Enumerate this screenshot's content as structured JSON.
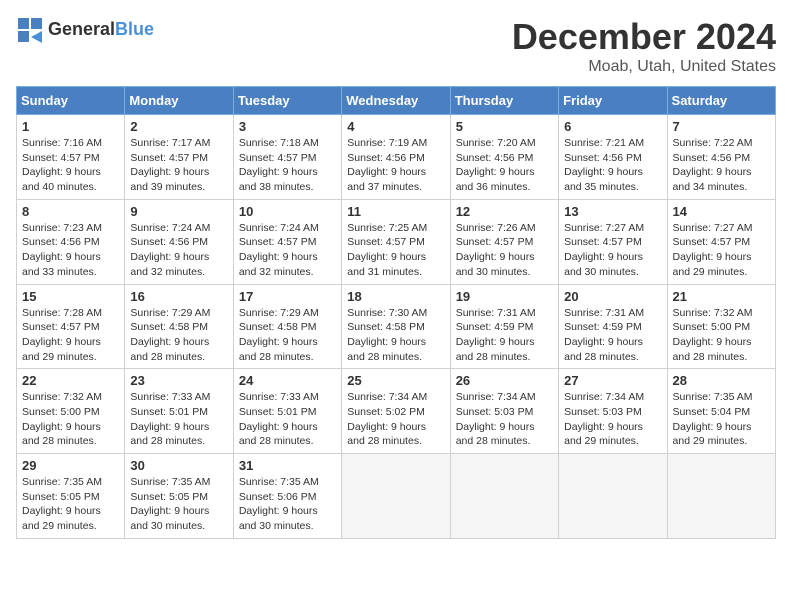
{
  "header": {
    "logo_general": "General",
    "logo_blue": "Blue",
    "month": "December 2024",
    "location": "Moab, Utah, United States"
  },
  "weekdays": [
    "Sunday",
    "Monday",
    "Tuesday",
    "Wednesday",
    "Thursday",
    "Friday",
    "Saturday"
  ],
  "weeks": [
    [
      {
        "day": "1",
        "info": "Sunrise: 7:16 AM\nSunset: 4:57 PM\nDaylight: 9 hours\nand 40 minutes."
      },
      {
        "day": "2",
        "info": "Sunrise: 7:17 AM\nSunset: 4:57 PM\nDaylight: 9 hours\nand 39 minutes."
      },
      {
        "day": "3",
        "info": "Sunrise: 7:18 AM\nSunset: 4:57 PM\nDaylight: 9 hours\nand 38 minutes."
      },
      {
        "day": "4",
        "info": "Sunrise: 7:19 AM\nSunset: 4:56 PM\nDaylight: 9 hours\nand 37 minutes."
      },
      {
        "day": "5",
        "info": "Sunrise: 7:20 AM\nSunset: 4:56 PM\nDaylight: 9 hours\nand 36 minutes."
      },
      {
        "day": "6",
        "info": "Sunrise: 7:21 AM\nSunset: 4:56 PM\nDaylight: 9 hours\nand 35 minutes."
      },
      {
        "day": "7",
        "info": "Sunrise: 7:22 AM\nSunset: 4:56 PM\nDaylight: 9 hours\nand 34 minutes."
      }
    ],
    [
      {
        "day": "8",
        "info": "Sunrise: 7:23 AM\nSunset: 4:56 PM\nDaylight: 9 hours\nand 33 minutes."
      },
      {
        "day": "9",
        "info": "Sunrise: 7:24 AM\nSunset: 4:56 PM\nDaylight: 9 hours\nand 32 minutes."
      },
      {
        "day": "10",
        "info": "Sunrise: 7:24 AM\nSunset: 4:57 PM\nDaylight: 9 hours\nand 32 minutes."
      },
      {
        "day": "11",
        "info": "Sunrise: 7:25 AM\nSunset: 4:57 PM\nDaylight: 9 hours\nand 31 minutes."
      },
      {
        "day": "12",
        "info": "Sunrise: 7:26 AM\nSunset: 4:57 PM\nDaylight: 9 hours\nand 30 minutes."
      },
      {
        "day": "13",
        "info": "Sunrise: 7:27 AM\nSunset: 4:57 PM\nDaylight: 9 hours\nand 30 minutes."
      },
      {
        "day": "14",
        "info": "Sunrise: 7:27 AM\nSunset: 4:57 PM\nDaylight: 9 hours\nand 29 minutes."
      }
    ],
    [
      {
        "day": "15",
        "info": "Sunrise: 7:28 AM\nSunset: 4:57 PM\nDaylight: 9 hours\nand 29 minutes."
      },
      {
        "day": "16",
        "info": "Sunrise: 7:29 AM\nSunset: 4:58 PM\nDaylight: 9 hours\nand 28 minutes."
      },
      {
        "day": "17",
        "info": "Sunrise: 7:29 AM\nSunset: 4:58 PM\nDaylight: 9 hours\nand 28 minutes."
      },
      {
        "day": "18",
        "info": "Sunrise: 7:30 AM\nSunset: 4:58 PM\nDaylight: 9 hours\nand 28 minutes."
      },
      {
        "day": "19",
        "info": "Sunrise: 7:31 AM\nSunset: 4:59 PM\nDaylight: 9 hours\nand 28 minutes."
      },
      {
        "day": "20",
        "info": "Sunrise: 7:31 AM\nSunset: 4:59 PM\nDaylight: 9 hours\nand 28 minutes."
      },
      {
        "day": "21",
        "info": "Sunrise: 7:32 AM\nSunset: 5:00 PM\nDaylight: 9 hours\nand 28 minutes."
      }
    ],
    [
      {
        "day": "22",
        "info": "Sunrise: 7:32 AM\nSunset: 5:00 PM\nDaylight: 9 hours\nand 28 minutes."
      },
      {
        "day": "23",
        "info": "Sunrise: 7:33 AM\nSunset: 5:01 PM\nDaylight: 9 hours\nand 28 minutes."
      },
      {
        "day": "24",
        "info": "Sunrise: 7:33 AM\nSunset: 5:01 PM\nDaylight: 9 hours\nand 28 minutes."
      },
      {
        "day": "25",
        "info": "Sunrise: 7:34 AM\nSunset: 5:02 PM\nDaylight: 9 hours\nand 28 minutes."
      },
      {
        "day": "26",
        "info": "Sunrise: 7:34 AM\nSunset: 5:03 PM\nDaylight: 9 hours\nand 28 minutes."
      },
      {
        "day": "27",
        "info": "Sunrise: 7:34 AM\nSunset: 5:03 PM\nDaylight: 9 hours\nand 29 minutes."
      },
      {
        "day": "28",
        "info": "Sunrise: 7:35 AM\nSunset: 5:04 PM\nDaylight: 9 hours\nand 29 minutes."
      }
    ],
    [
      {
        "day": "29",
        "info": "Sunrise: 7:35 AM\nSunset: 5:05 PM\nDaylight: 9 hours\nand 29 minutes."
      },
      {
        "day": "30",
        "info": "Sunrise: 7:35 AM\nSunset: 5:05 PM\nDaylight: 9 hours\nand 30 minutes."
      },
      {
        "day": "31",
        "info": "Sunrise: 7:35 AM\nSunset: 5:06 PM\nDaylight: 9 hours\nand 30 minutes."
      },
      null,
      null,
      null,
      null
    ]
  ]
}
